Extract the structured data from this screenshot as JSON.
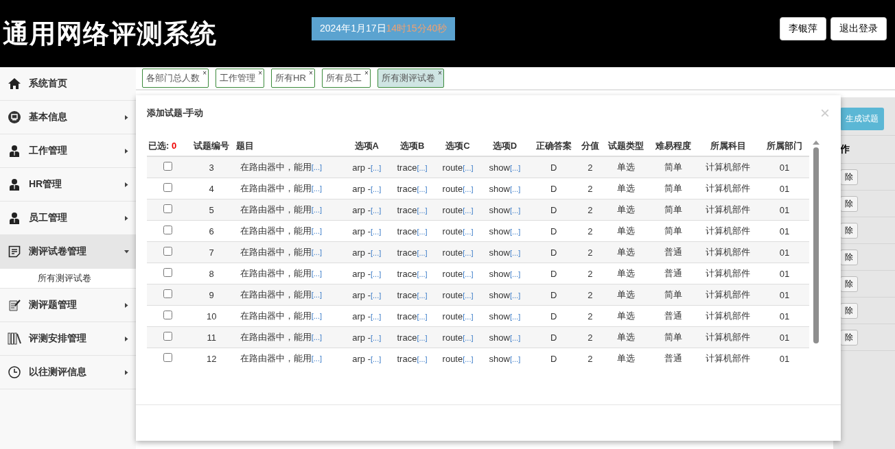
{
  "header": {
    "title": "通用网络评测系统",
    "date": "2024年1月17日",
    "time": "14时15分40秒",
    "user": "李银萍",
    "logout": "退出登录"
  },
  "sidebar": {
    "items": [
      {
        "label": "系统首页",
        "expanded": false
      },
      {
        "label": "基本信息",
        "expanded": false
      },
      {
        "label": "工作管理",
        "expanded": false
      },
      {
        "label": "HR管理",
        "expanded": false
      },
      {
        "label": "员工管理",
        "expanded": false
      },
      {
        "label": "测评试卷管理",
        "expanded": true,
        "children": [
          {
            "label": "所有测评试卷"
          }
        ]
      },
      {
        "label": "测评题管理",
        "expanded": false
      },
      {
        "label": "评测安排管理",
        "expanded": false
      },
      {
        "label": "以往测评信息",
        "expanded": false
      }
    ]
  },
  "tabs": [
    {
      "label": "各部门总人数",
      "close": "×",
      "selected": false
    },
    {
      "label": "工作管理",
      "close": "×",
      "selected": false
    },
    {
      "label": "所有HR",
      "close": "×",
      "selected": false
    },
    {
      "label": "所有员工",
      "close": "×",
      "selected": false
    },
    {
      "label": "所有测评试卷",
      "close": "×",
      "selected": true
    }
  ],
  "background": {
    "generate_button": "生成试题",
    "column_header": "作",
    "row_buttons": [
      "除",
      "除",
      "除",
      "除",
      "除",
      "除",
      "除"
    ]
  },
  "modal": {
    "title": "添加试题-手动",
    "close": "×",
    "selected_label": "已选:",
    "selected_count": "0",
    "columns": [
      "试题编号",
      "题目",
      "选项A",
      "选项B",
      "选项C",
      "选项D",
      "正确答案",
      "分值",
      "试题类型",
      "难易程度",
      "所属科目",
      "所属部门"
    ],
    "rows": [
      {
        "checked": false,
        "cells": [
          "3",
          "在路由器中，能用",
          "arp -",
          "trace",
          "route",
          "show",
          "D",
          "2",
          "单选",
          "简单",
          "计算机部件",
          "01"
        ],
        "more": "[...]"
      },
      {
        "checked": false,
        "cells": [
          "4",
          "在路由器中，能用",
          "arp -",
          "trace",
          "route",
          "show",
          "D",
          "2",
          "单选",
          "简单",
          "计算机部件",
          "01"
        ],
        "more": "[...]"
      },
      {
        "checked": false,
        "cells": [
          "5",
          "在路由器中，能用",
          "arp -",
          "trace",
          "route",
          "show",
          "D",
          "2",
          "单选",
          "简单",
          "计算机部件",
          "01"
        ],
        "more": "[...]"
      },
      {
        "checked": false,
        "cells": [
          "6",
          "在路由器中，能用",
          "arp -",
          "trace",
          "route",
          "show",
          "D",
          "2",
          "单选",
          "简单",
          "计算机部件",
          "01"
        ],
        "more": "[...]"
      },
      {
        "checked": false,
        "cells": [
          "7",
          "在路由器中，能用",
          "arp -",
          "trace",
          "route",
          "show",
          "D",
          "2",
          "单选",
          "普通",
          "计算机部件",
          "01"
        ],
        "more": "[...]"
      },
      {
        "checked": false,
        "cells": [
          "8",
          "在路由器中，能用",
          "arp -",
          "trace",
          "route",
          "show",
          "D",
          "2",
          "单选",
          "普通",
          "计算机部件",
          "01"
        ],
        "more": "[...]"
      },
      {
        "checked": false,
        "cells": [
          "9",
          "在路由器中，能用",
          "arp -",
          "trace",
          "route",
          "show",
          "D",
          "2",
          "单选",
          "简单",
          "计算机部件",
          "01"
        ],
        "more": "[...]"
      },
      {
        "checked": false,
        "cells": [
          "10",
          "在路由器中，能用",
          "arp -",
          "trace",
          "route",
          "show",
          "D",
          "2",
          "单选",
          "普通",
          "计算机部件",
          "01"
        ],
        "more": "[...]"
      },
      {
        "checked": false,
        "cells": [
          "11",
          "在路由器中，能用",
          "arp -",
          "trace",
          "route",
          "show",
          "D",
          "2",
          "单选",
          "简单",
          "计算机部件",
          "01"
        ],
        "more": "[...]"
      },
      {
        "checked": false,
        "cells": [
          "12",
          "在路由器中，能用",
          "arp -",
          "trace",
          "route",
          "show",
          "D",
          "2",
          "单选",
          "普通",
          "计算机部件",
          "01"
        ],
        "more": "[...]"
      }
    ]
  }
}
